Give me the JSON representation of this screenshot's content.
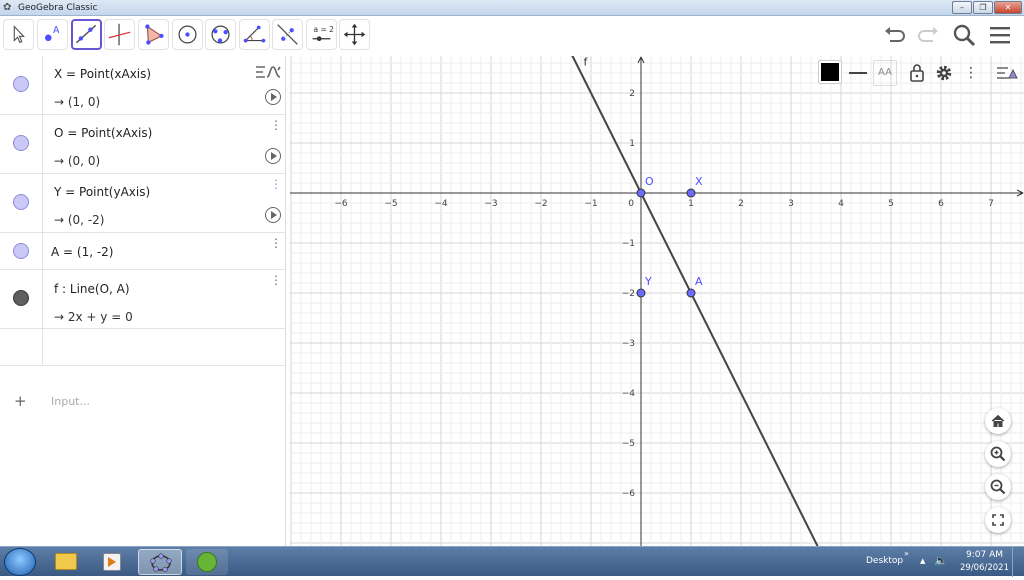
{
  "window": {
    "title": "GeoGebra Classic"
  },
  "toolbar": {
    "tools": [
      "move-tool",
      "point-tool",
      "line-tool",
      "perpendicular-tool",
      "polygon-tool",
      "circle-tool",
      "circle-three-points-tool",
      "angle-tool",
      "reflect-tool",
      "slider-tool",
      "move-graphics-tool"
    ],
    "slider_label": "a = 2",
    "active_tool": "line-tool"
  },
  "algebra": {
    "items": [
      {
        "definition": "X = Point(xAxis)",
        "value": "→  (1, 0)"
      },
      {
        "definition": "O = Point(xAxis)",
        "value": "→  (0, 0)"
      },
      {
        "definition": "Y = Point(yAxis)",
        "value": "→  (0, -2)"
      },
      {
        "definition": "A = (1, -2)",
        "value": ""
      },
      {
        "definition": "f : Line(O, A)",
        "value": "→  2x + y = 0"
      }
    ],
    "input_placeholder": "Input..."
  },
  "graph": {
    "x_ticks": [
      "−6",
      "−5",
      "−4",
      "−3",
      "−2",
      "−1",
      "0",
      "1",
      "2",
      "3",
      "4",
      "5",
      "6",
      "7"
    ],
    "y_ticks": [
      "2",
      "1",
      "−1",
      "−2",
      "−3",
      "−4",
      "−5",
      "−6"
    ],
    "points": [
      {
        "label": "O",
        "x": 0,
        "y": 0
      },
      {
        "label": "X",
        "x": 1,
        "y": 0
      },
      {
        "label": "Y",
        "x": 0,
        "y": -2
      },
      {
        "label": "A",
        "x": 1,
        "y": -2
      }
    ],
    "line_label": "f",
    "line_equation": "2x + y = 0",
    "font_size_label": "AA",
    "colors": {
      "point": "#4d4dff",
      "point_fill": "#6b6bff",
      "line": "#444444",
      "grid_major": "#d4d4d4",
      "grid_minor": "#eeeeee"
    }
  },
  "taskbar": {
    "desktop_label": "Desktop",
    "time": "9:07 AM",
    "date": "29/06/2021"
  }
}
